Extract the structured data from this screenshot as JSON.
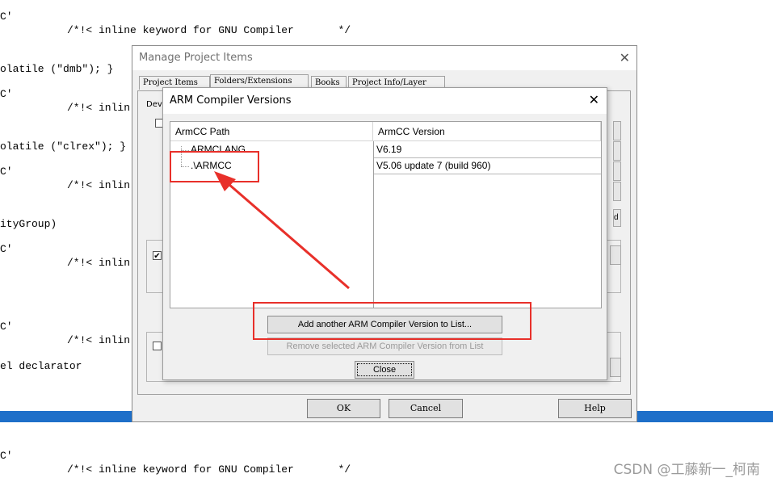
{
  "background_code": {
    "lines": [
      "C'",
      "/*!< inline keyword for GNU Compiler       */",
      "olatile (\"dmb\"); }",
      "C'",
      "/*!< inlin",
      "olatile (\"clrex\"); }",
      "C'",
      "/*!< inlin",
      "ityGroup)",
      "C'",
      "/*!< inlin",
      "C'",
      "/*!< inlin",
      "el declarator",
      "C'",
      "/*!< inline keyword for GNU Compiler       */"
    ]
  },
  "watermark": "CSDN @工藤新一_柯南",
  "manage_window": {
    "title": "Manage Project Items",
    "tabs": [
      "Project Items",
      "Folders/Extensions",
      "Books",
      "Project Info/Layer"
    ],
    "active_tab": "Folders/Extensions",
    "partial_label": "Deve",
    "side_fragment": "d",
    "buttons": {
      "ok": "OK",
      "cancel": "Cancel",
      "help": "Help"
    }
  },
  "compiler_dialog": {
    "title": "ARM Compiler Versions",
    "columns": [
      "ArmCC Path",
      "ArmCC Version"
    ],
    "rows": [
      {
        "path": "ARMCLANG",
        "version": "V6.19"
      },
      {
        "path": ".\\ARMCC",
        "version": "V5.06 update 7 (build 960)"
      }
    ],
    "buttons": {
      "add": "Add another ARM Compiler Version to List...",
      "remove": "Remove selected ARM Compiler Version from List",
      "close": "Close"
    },
    "remove_enabled": false
  },
  "annotations": {
    "highlight_color": "#e8302a"
  },
  "colors": {
    "accent_band": "#1e6fc9"
  }
}
